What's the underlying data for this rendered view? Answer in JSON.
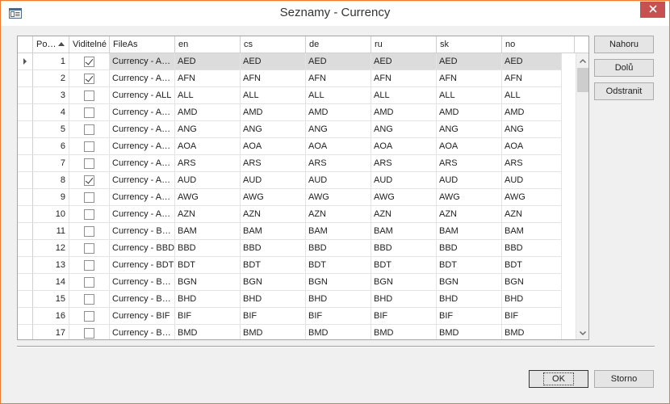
{
  "window": {
    "title": "Seznamy - Currency"
  },
  "grid": {
    "headers": [
      "Po…",
      "Viditelné",
      "FileAs",
      "en",
      "cs",
      "de",
      "ru",
      "sk",
      "no"
    ],
    "rows": [
      {
        "num": "1",
        "visible": true,
        "fileas": "Currency - A…",
        "code": "AED",
        "selected": true
      },
      {
        "num": "2",
        "visible": true,
        "fileas": "Currency - A…",
        "code": "AFN"
      },
      {
        "num": "3",
        "visible": false,
        "fileas": "Currency - ALL",
        "code": "ALL"
      },
      {
        "num": "4",
        "visible": false,
        "fileas": "Currency - A…",
        "code": "AMD"
      },
      {
        "num": "5",
        "visible": false,
        "fileas": "Currency - A…",
        "code": "ANG"
      },
      {
        "num": "6",
        "visible": false,
        "fileas": "Currency - A…",
        "code": "AOA"
      },
      {
        "num": "7",
        "visible": false,
        "fileas": "Currency - A…",
        "code": "ARS"
      },
      {
        "num": "8",
        "visible": true,
        "fileas": "Currency - A…",
        "code": "AUD"
      },
      {
        "num": "9",
        "visible": false,
        "fileas": "Currency - A…",
        "code": "AWG"
      },
      {
        "num": "10",
        "visible": false,
        "fileas": "Currency - A…",
        "code": "AZN"
      },
      {
        "num": "11",
        "visible": false,
        "fileas": "Currency - B…",
        "code": "BAM"
      },
      {
        "num": "12",
        "visible": false,
        "fileas": "Currency - BBD",
        "code": "BBD"
      },
      {
        "num": "13",
        "visible": false,
        "fileas": "Currency - BDT",
        "code": "BDT"
      },
      {
        "num": "14",
        "visible": false,
        "fileas": "Currency - B…",
        "code": "BGN"
      },
      {
        "num": "15",
        "visible": false,
        "fileas": "Currency - B…",
        "code": "BHD"
      },
      {
        "num": "16",
        "visible": false,
        "fileas": "Currency - BIF",
        "code": "BIF"
      },
      {
        "num": "17",
        "visible": false,
        "fileas": "Currency - B…",
        "code": "BMD"
      }
    ]
  },
  "side_buttons": {
    "up": "Nahoru",
    "down": "Dolů",
    "remove": "Odstranit"
  },
  "footer_buttons": {
    "ok": "OK",
    "cancel": "Storno"
  },
  "icons": {
    "title": "window-list-icon",
    "close": "close-icon",
    "sort": "sort-ascending-icon"
  }
}
